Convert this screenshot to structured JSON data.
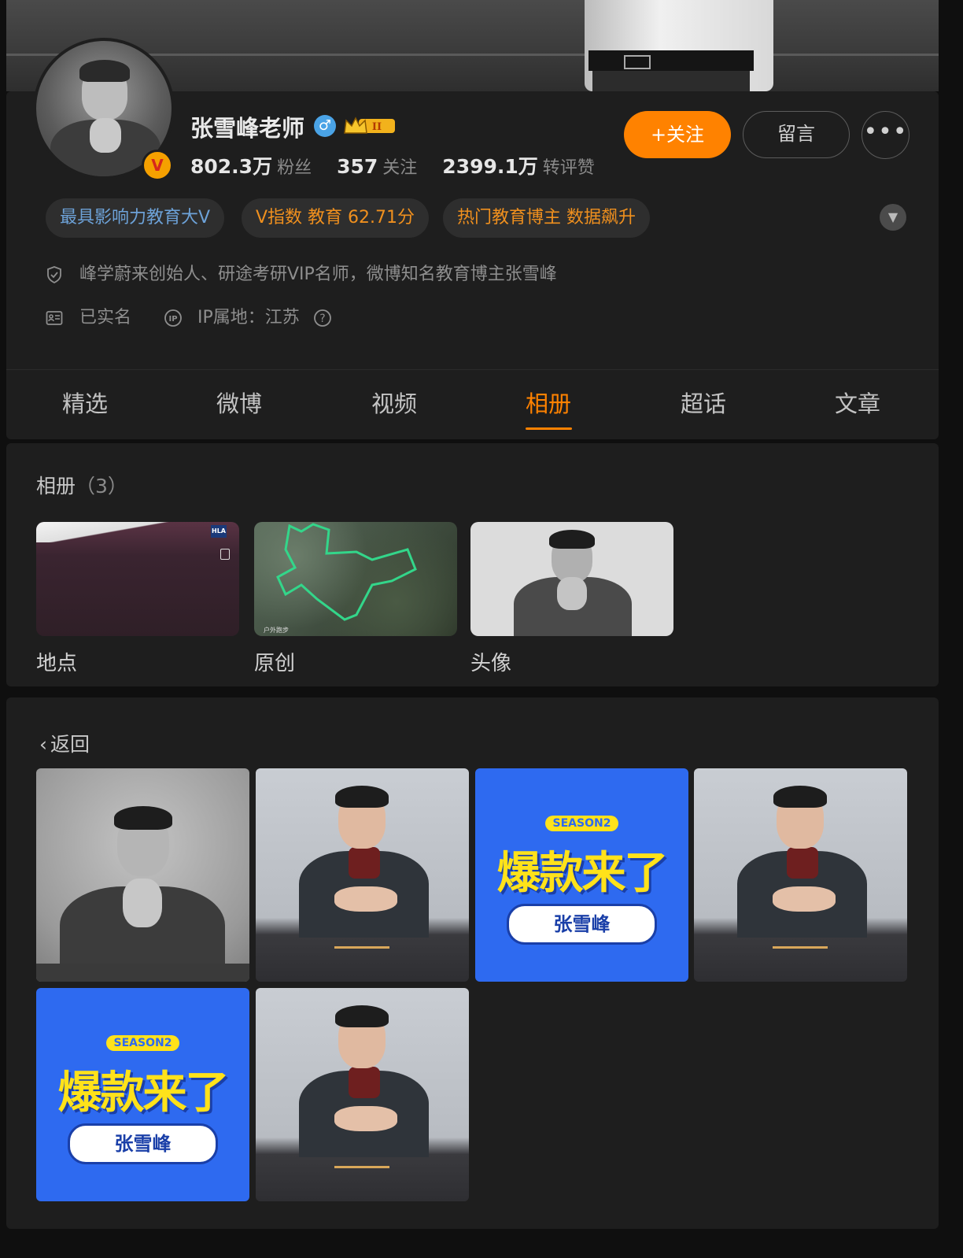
{
  "profile": {
    "name": "张雪峰老师",
    "gender_symbol": "♂",
    "verified_badge": "V",
    "stats": [
      {
        "value": "802.3万",
        "label": "粉丝"
      },
      {
        "value": "357",
        "label": "关注"
      },
      {
        "value": "2399.1万",
        "label": "转评赞"
      }
    ],
    "actions": {
      "follow": "+关注",
      "message": "留言",
      "more": "•••"
    },
    "tags": [
      "最具影响力教育大V",
      "V指数 教育 62.71分",
      "热门教育博主 数据飙升"
    ],
    "bio": "峰学蔚来创始人、研途考研VIP名师，微博知名教育博主张雪峰",
    "realname": "已实名",
    "ip_location": "IP属地：江苏"
  },
  "tabs": [
    "精选",
    "微博",
    "视频",
    "相册",
    "超话",
    "文章"
  ],
  "active_tab": "相册",
  "albums": {
    "title": "相册",
    "count": "（3）",
    "items": [
      {
        "label": "地点",
        "overlay": "HLA"
      },
      {
        "label": "原创",
        "overlay": "户外跑步"
      },
      {
        "label": "头像"
      }
    ]
  },
  "photos": {
    "back_label": "返回",
    "poster": {
      "season": "SEASON2",
      "title": "爆款来了",
      "name": "张雪峰"
    }
  },
  "colors": {
    "accent": "#ff8200",
    "tag_blue": "#6da2d8",
    "poster_blue": "#2e6af0",
    "poster_yellow": "#ffe21a"
  }
}
